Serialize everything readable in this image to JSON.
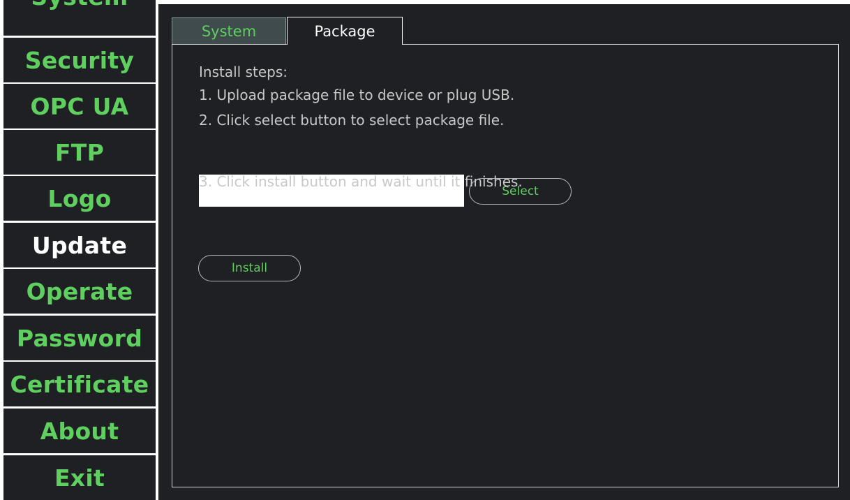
{
  "sidebar": {
    "items": [
      {
        "label": "System"
      },
      {
        "label": "Security"
      },
      {
        "label": "OPC UA"
      },
      {
        "label": "FTP"
      },
      {
        "label": "Logo"
      },
      {
        "label": "Update"
      },
      {
        "label": "Operate"
      },
      {
        "label": "Password"
      },
      {
        "label": "Certificate"
      },
      {
        "label": "About"
      },
      {
        "label": "Exit"
      }
    ],
    "active": "Update"
  },
  "tabs": [
    {
      "label": "System",
      "selected": false
    },
    {
      "label": "Package",
      "selected": true
    }
  ],
  "package": {
    "heading": "Install steps:",
    "step1": "1. Upload package file to device or plug USB.",
    "step2": "2. Click select button to select package file.",
    "file_value": "",
    "select_label": "Select",
    "step3": "3. Click install button and wait until it finishes.",
    "install_label": "Install"
  },
  "colors": {
    "background": "#1e2023",
    "accent_green": "#5fcf5f",
    "tab_inactive": "#3f4b4d",
    "text_muted": "#c8c8c8"
  }
}
